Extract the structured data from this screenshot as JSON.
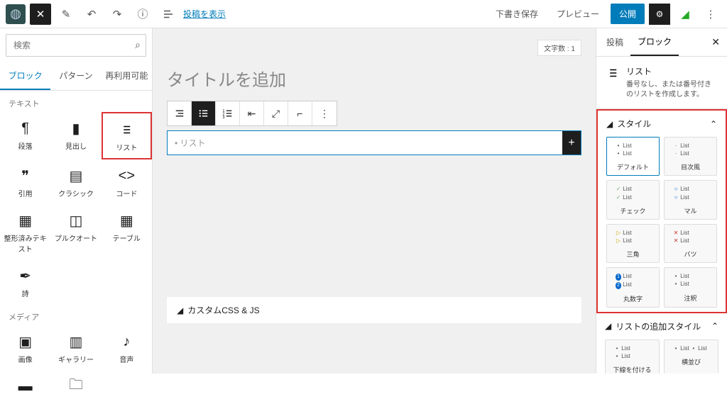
{
  "top": {
    "view_link": "投稿を表示",
    "draft_save": "下書き保存",
    "preview": "プレビュー",
    "publish": "公開"
  },
  "left": {
    "search_placeholder": "検索",
    "tabs": [
      "ブロック",
      "パターン",
      "再利用可能"
    ],
    "cat_text": "テキスト",
    "cat_media": "メディア",
    "blocks_text": [
      "段落",
      "見出し",
      "リスト",
      "引用",
      "クラシック",
      "コード",
      "整形済みテキスト",
      "プルクオート",
      "テーブル",
      "詩"
    ],
    "blocks_media": [
      "画像",
      "ギャラリー",
      "音声"
    ]
  },
  "center": {
    "title_placeholder": "タイトルを追加",
    "word_count": "文字数 : 1",
    "list_placeholder": "• リスト",
    "accordion": "カスタムCSS & JS"
  },
  "right": {
    "tabs": [
      "投稿",
      "ブロック"
    ],
    "info_title": "リスト",
    "info_desc": "番号なし、または番号付きのリストを作成します。",
    "panel_style": "スタイル",
    "panel_add": "リストの追加スタイル",
    "list_txt": "List",
    "styles": [
      "デフォルト",
      "目次風",
      "チェック",
      "マル",
      "三角",
      "バツ",
      "丸数字",
      "注釈"
    ],
    "styles_add": [
      "下線を付ける",
      "横並び"
    ]
  }
}
